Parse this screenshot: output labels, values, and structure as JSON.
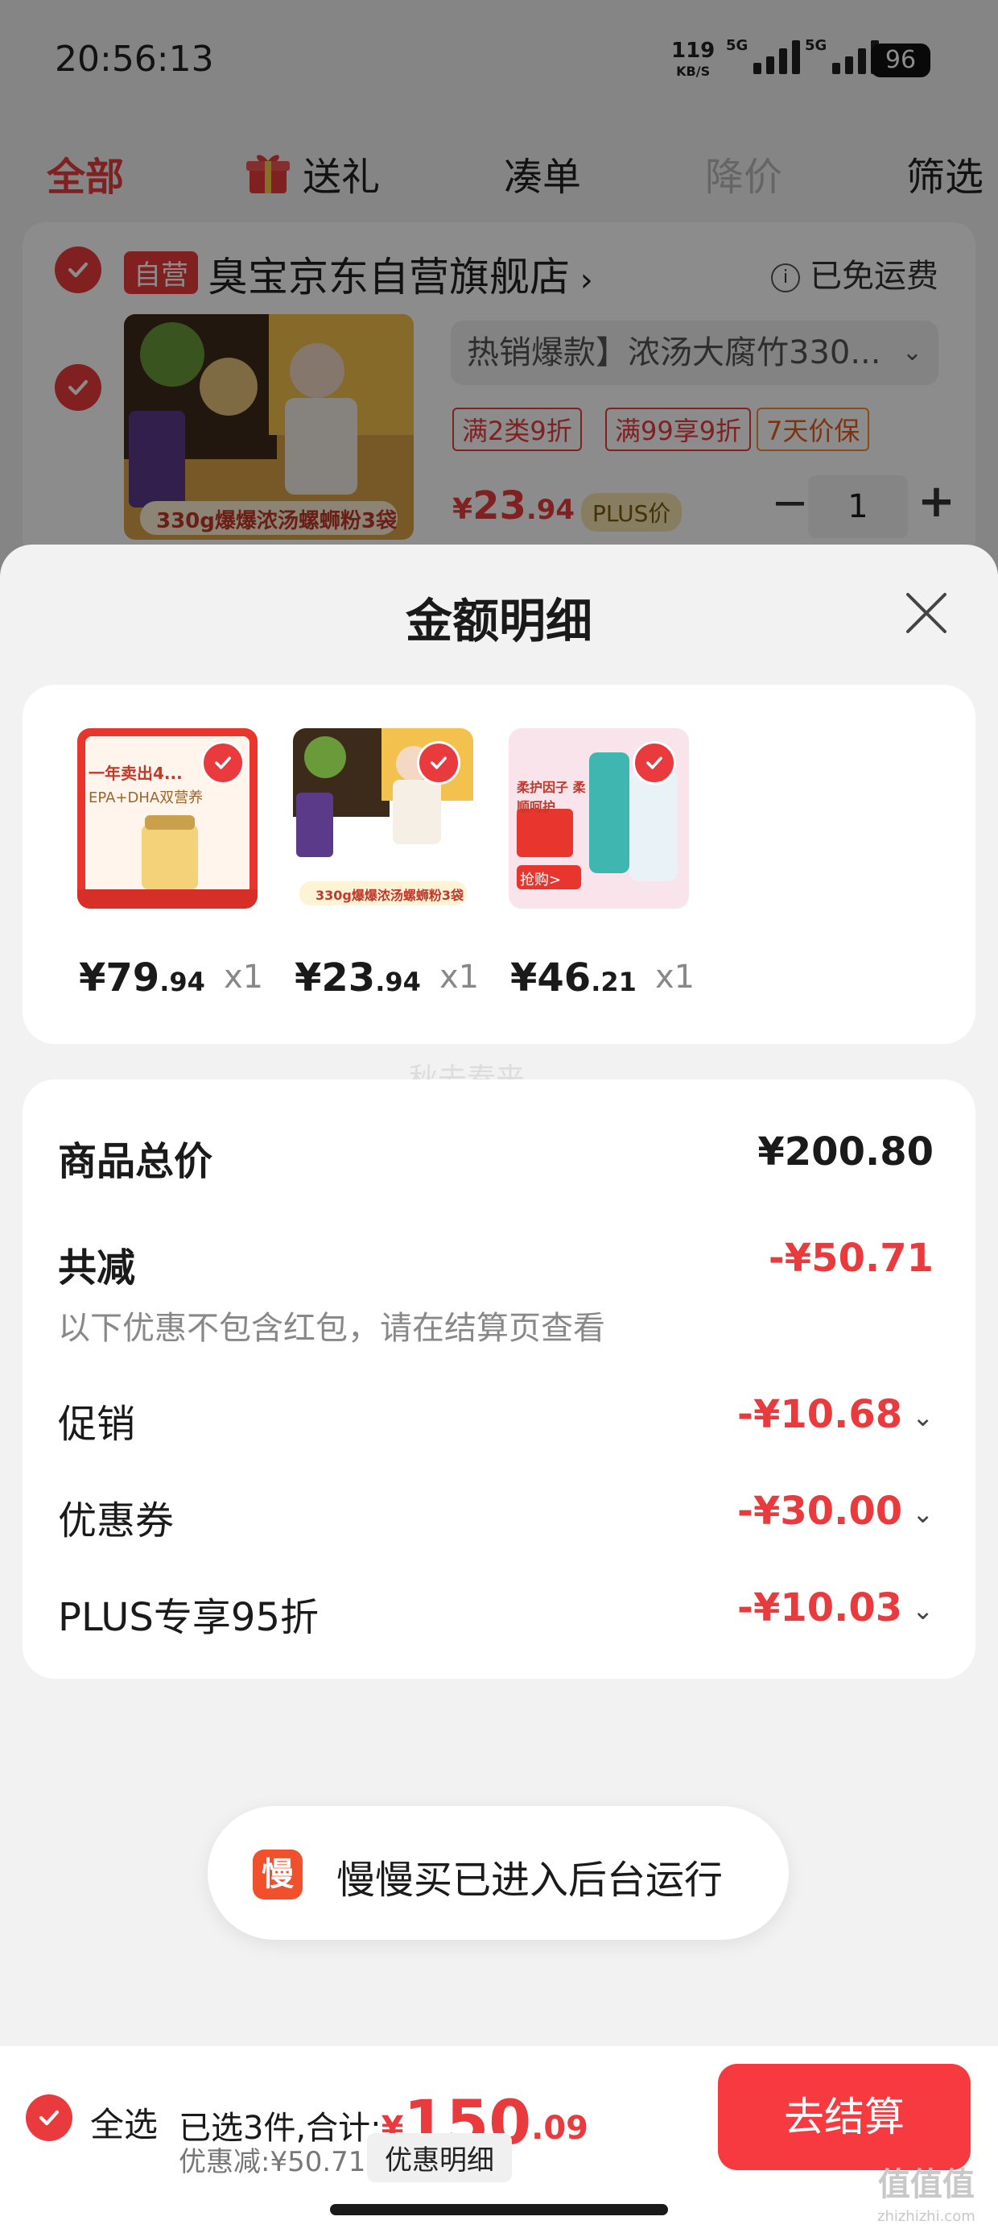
{
  "status_bar": {
    "time": "20:56:13",
    "speed_value": "119",
    "speed_unit": "KB/S",
    "sig1_label": "5G",
    "sig2_label": "5G",
    "battery": "96"
  },
  "tabs": [
    {
      "label": "全部"
    },
    {
      "label": "送礼",
      "icon": "gift-icon"
    },
    {
      "label": "凑单"
    },
    {
      "label": "降价"
    },
    {
      "label": "筛选"
    }
  ],
  "store": {
    "badge": "自营",
    "name": "臭宝京东自营旗舰店",
    "shipping": "已免运费",
    "product": {
      "title": "热销爆款】浓汤大腐竹330...",
      "tags": [
        "满2类9折",
        "满99享9折",
        "7天价保"
      ],
      "price_sym": "¥",
      "price_int": "23",
      "price_dec": ".94",
      "plus_label": "PLUS价",
      "image_caption": "330g爆爆浓汤螺蛳粉3袋",
      "qty": "1",
      "minus": "−",
      "plus": "+"
    }
  },
  "sheet": {
    "title": "金额明细",
    "watermark": "秋去春来",
    "items": [
      {
        "price_sym": "¥",
        "price_int": "79",
        "price_dec": ".94",
        "qty": "x1",
        "img_caption": "一年卖出4...",
        "img_line": "EPA+DHA双营养"
      },
      {
        "price_sym": "¥",
        "price_int": "23",
        "price_dec": ".94",
        "qty": "x1",
        "img_caption": "330g爆爆浓汤螺蛳粉3袋"
      },
      {
        "price_sym": "¥",
        "price_int": "46",
        "price_dec": ".21",
        "qty": "x1",
        "img_caption": "柔护因子 柔顺呵护",
        "img_line": "抢购>"
      }
    ],
    "summary": {
      "total_label": "商品总价",
      "total_value": "¥200.80",
      "reduce_label": "共减",
      "reduce_value": "-¥50.71",
      "note": "以下优惠不包含红包，请在结算页查看",
      "rows": [
        {
          "label": "促销",
          "value": "-¥10.68"
        },
        {
          "label": "优惠券",
          "value": "-¥30.00"
        },
        {
          "label": "PLUS专享95折",
          "value": "-¥10.03"
        }
      ]
    }
  },
  "toast": {
    "icon_char": "慢",
    "text": "慢慢买已进入后台运行"
  },
  "bottom": {
    "select_all": "全选",
    "selected_text": "已选3件,合计:",
    "total_sym": "¥",
    "total_int": "150",
    "total_dec": ".09",
    "discount_text": "优惠减:¥50.71",
    "detail_button": "优惠明细",
    "checkout": "去结算"
  },
  "corner_watermark": {
    "logo": "值值值",
    "domain": "zhizhizhi.com"
  },
  "colors": {
    "accent": "#e93b3d",
    "checkout": "#f73a3f"
  }
}
